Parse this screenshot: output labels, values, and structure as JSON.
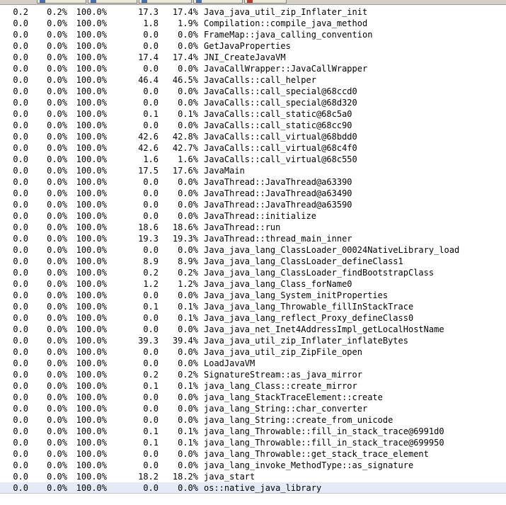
{
  "rows": [
    {
      "c1": "0.2",
      "c2": "0.2%",
      "c3": "100.0%",
      "c4": "17.3",
      "c5": "17.4%",
      "name": "Java_java_util_zip_Inflater_init"
    },
    {
      "c1": "0.0",
      "c2": "0.0%",
      "c3": "100.0%",
      "c4": "1.8",
      "c5": "1.9%",
      "name": "Compilation::compile_java_method"
    },
    {
      "c1": "0.0",
      "c2": "0.0%",
      "c3": "100.0%",
      "c4": "0.0",
      "c5": "0.0%",
      "name": "FrameMap::java_calling_convention"
    },
    {
      "c1": "0.0",
      "c2": "0.0%",
      "c3": "100.0%",
      "c4": "0.0",
      "c5": "0.0%",
      "name": "GetJavaProperties"
    },
    {
      "c1": "0.0",
      "c2": "0.0%",
      "c3": "100.0%",
      "c4": "17.4",
      "c5": "17.4%",
      "name": "JNI_CreateJavaVM"
    },
    {
      "c1": "0.0",
      "c2": "0.0%",
      "c3": "100.0%",
      "c4": "0.0",
      "c5": "0.0%",
      "name": "JavaCallWrapper::JavaCallWrapper"
    },
    {
      "c1": "0.0",
      "c2": "0.0%",
      "c3": "100.0%",
      "c4": "46.4",
      "c5": "46.5%",
      "name": "JavaCalls::call_helper"
    },
    {
      "c1": "0.0",
      "c2": "0.0%",
      "c3": "100.0%",
      "c4": "0.0",
      "c5": "0.0%",
      "name": "JavaCalls::call_special@68ccd0"
    },
    {
      "c1": "0.0",
      "c2": "0.0%",
      "c3": "100.0%",
      "c4": "0.0",
      "c5": "0.0%",
      "name": "JavaCalls::call_special@68d320"
    },
    {
      "c1": "0.0",
      "c2": "0.0%",
      "c3": "100.0%",
      "c4": "0.1",
      "c5": "0.1%",
      "name": "JavaCalls::call_static@68c5a0"
    },
    {
      "c1": "0.0",
      "c2": "0.0%",
      "c3": "100.0%",
      "c4": "0.0",
      "c5": "0.0%",
      "name": "JavaCalls::call_static@68cc90"
    },
    {
      "c1": "0.0",
      "c2": "0.0%",
      "c3": "100.0%",
      "c4": "42.6",
      "c5": "42.8%",
      "name": "JavaCalls::call_virtual@68bdd0"
    },
    {
      "c1": "0.0",
      "c2": "0.0%",
      "c3": "100.0%",
      "c4": "42.6",
      "c5": "42.7%",
      "name": "JavaCalls::call_virtual@68c4f0"
    },
    {
      "c1": "0.0",
      "c2": "0.0%",
      "c3": "100.0%",
      "c4": "1.6",
      "c5": "1.6%",
      "name": "JavaCalls::call_virtual@68c550"
    },
    {
      "c1": "0.0",
      "c2": "0.0%",
      "c3": "100.0%",
      "c4": "17.5",
      "c5": "17.6%",
      "name": "JavaMain"
    },
    {
      "c1": "0.0",
      "c2": "0.0%",
      "c3": "100.0%",
      "c4": "0.0",
      "c5": "0.0%",
      "name": "JavaThread::JavaThread@a63390"
    },
    {
      "c1": "0.0",
      "c2": "0.0%",
      "c3": "100.0%",
      "c4": "0.0",
      "c5": "0.0%",
      "name": "JavaThread::JavaThread@a63490"
    },
    {
      "c1": "0.0",
      "c2": "0.0%",
      "c3": "100.0%",
      "c4": "0.0",
      "c5": "0.0%",
      "name": "JavaThread::JavaThread@a63590"
    },
    {
      "c1": "0.0",
      "c2": "0.0%",
      "c3": "100.0%",
      "c4": "0.0",
      "c5": "0.0%",
      "name": "JavaThread::initialize"
    },
    {
      "c1": "0.0",
      "c2": "0.0%",
      "c3": "100.0%",
      "c4": "18.6",
      "c5": "18.6%",
      "name": "JavaThread::run"
    },
    {
      "c1": "0.0",
      "c2": "0.0%",
      "c3": "100.0%",
      "c4": "19.3",
      "c5": "19.3%",
      "name": "JavaThread::thread_main_inner"
    },
    {
      "c1": "0.0",
      "c2": "0.0%",
      "c3": "100.0%",
      "c4": "0.0",
      "c5": "0.0%",
      "name": "Java_java_lang_ClassLoader_00024NativeLibrary_load"
    },
    {
      "c1": "0.0",
      "c2": "0.0%",
      "c3": "100.0%",
      "c4": "8.9",
      "c5": "8.9%",
      "name": "Java_java_lang_ClassLoader_defineClass1"
    },
    {
      "c1": "0.0",
      "c2": "0.0%",
      "c3": "100.0%",
      "c4": "0.2",
      "c5": "0.2%",
      "name": "Java_java_lang_ClassLoader_findBootstrapClass"
    },
    {
      "c1": "0.0",
      "c2": "0.0%",
      "c3": "100.0%",
      "c4": "1.2",
      "c5": "1.2%",
      "name": "Java_java_lang_Class_forName0"
    },
    {
      "c1": "0.0",
      "c2": "0.0%",
      "c3": "100.0%",
      "c4": "0.0",
      "c5": "0.0%",
      "name": "Java_java_lang_System_initProperties"
    },
    {
      "c1": "0.0",
      "c2": "0.0%",
      "c3": "100.0%",
      "c4": "0.1",
      "c5": "0.1%",
      "name": "Java_java_lang_Throwable_fillInStackTrace"
    },
    {
      "c1": "0.0",
      "c2": "0.0%",
      "c3": "100.0%",
      "c4": "0.0",
      "c5": "0.1%",
      "name": "Java_java_lang_reflect_Proxy_defineClass0"
    },
    {
      "c1": "0.0",
      "c2": "0.0%",
      "c3": "100.0%",
      "c4": "0.0",
      "c5": "0.0%",
      "name": "Java_java_net_Inet4AddressImpl_getLocalHostName"
    },
    {
      "c1": "0.0",
      "c2": "0.0%",
      "c3": "100.0%",
      "c4": "39.3",
      "c5": "39.4%",
      "name": "Java_java_util_zip_Inflater_inflateBytes"
    },
    {
      "c1": "0.0",
      "c2": "0.0%",
      "c3": "100.0%",
      "c4": "0.0",
      "c5": "0.0%",
      "name": "Java_java_util_zip_ZipFile_open"
    },
    {
      "c1": "0.0",
      "c2": "0.0%",
      "c3": "100.0%",
      "c4": "0.0",
      "c5": "0.0%",
      "name": "LoadJavaVM"
    },
    {
      "c1": "0.0",
      "c2": "0.0%",
      "c3": "100.0%",
      "c4": "0.2",
      "c5": "0.2%",
      "name": "SignatureStream::as_java_mirror"
    },
    {
      "c1": "0.0",
      "c2": "0.0%",
      "c3": "100.0%",
      "c4": "0.1",
      "c5": "0.1%",
      "name": "java_lang_Class::create_mirror"
    },
    {
      "c1": "0.0",
      "c2": "0.0%",
      "c3": "100.0%",
      "c4": "0.0",
      "c5": "0.0%",
      "name": "java_lang_StackTraceElement::create"
    },
    {
      "c1": "0.0",
      "c2": "0.0%",
      "c3": "100.0%",
      "c4": "0.0",
      "c5": "0.0%",
      "name": "java_lang_String::char_converter"
    },
    {
      "c1": "0.0",
      "c2": "0.0%",
      "c3": "100.0%",
      "c4": "0.0",
      "c5": "0.0%",
      "name": "java_lang_String::create_from_unicode"
    },
    {
      "c1": "0.0",
      "c2": "0.0%",
      "c3": "100.0%",
      "c4": "0.1",
      "c5": "0.1%",
      "name": "java_lang_Throwable::fill_in_stack_trace@6991d0"
    },
    {
      "c1": "0.0",
      "c2": "0.0%",
      "c3": "100.0%",
      "c4": "0.1",
      "c5": "0.1%",
      "name": "java_lang_Throwable::fill_in_stack_trace@699950"
    },
    {
      "c1": "0.0",
      "c2": "0.0%",
      "c3": "100.0%",
      "c4": "0.0",
      "c5": "0.0%",
      "name": "java_lang_Throwable::get_stack_trace_element"
    },
    {
      "c1": "0.0",
      "c2": "0.0%",
      "c3": "100.0%",
      "c4": "0.0",
      "c5": "0.0%",
      "name": "java_lang_invoke_MethodType::as_signature"
    },
    {
      "c1": "0.0",
      "c2": "0.0%",
      "c3": "100.0%",
      "c4": "18.2",
      "c5": "18.2%",
      "name": "java_start"
    },
    {
      "c1": "0.0",
      "c2": "0.0%",
      "c3": "100.0%",
      "c4": "0.0",
      "c5": "0.0%",
      "name": "os::native_java_library"
    }
  ],
  "selected_index": 42,
  "colors": {
    "selection": "#e6eaf6",
    "text": "#000000",
    "tab_icon": "#4a6ea9",
    "tab_icon_active": "#c0392b"
  }
}
